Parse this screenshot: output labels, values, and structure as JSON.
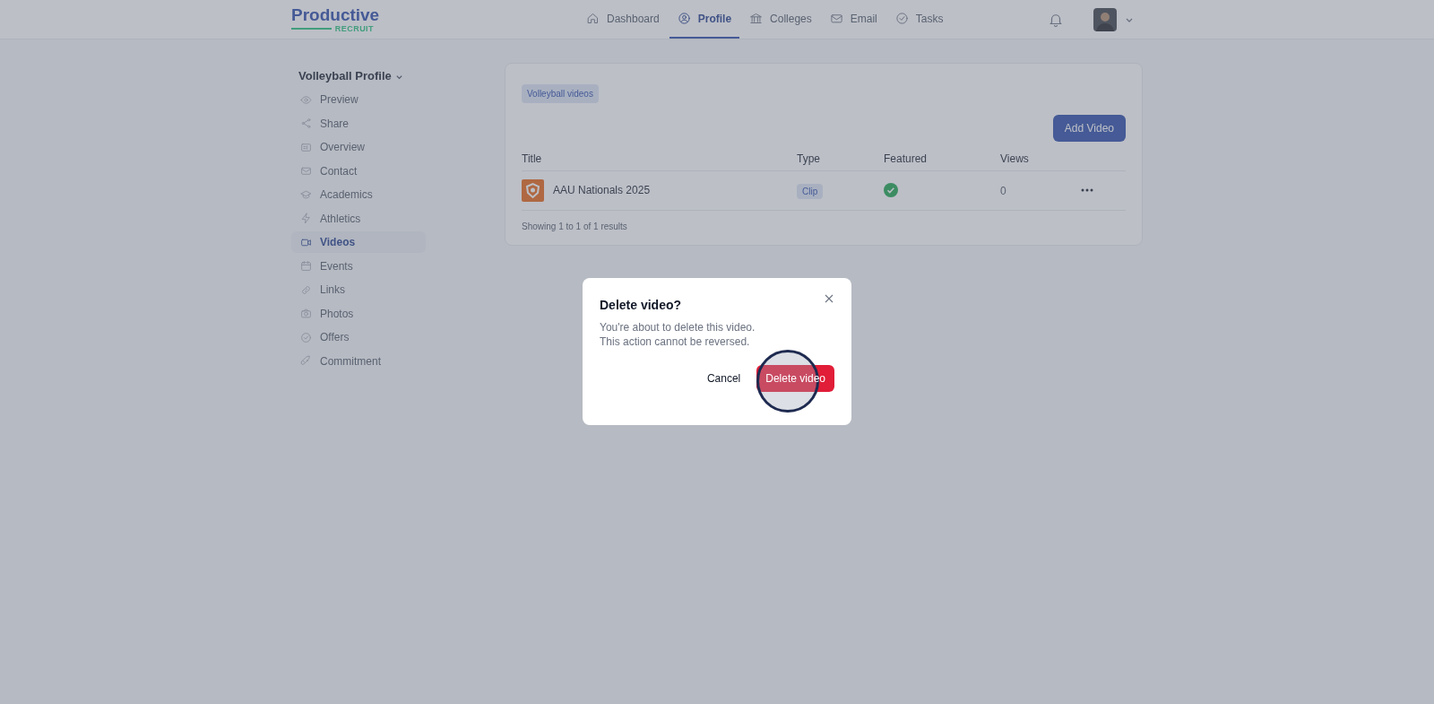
{
  "logo": {
    "word": "Productive",
    "sub": "RECRUIT"
  },
  "nav": [
    {
      "label": "Dashboard",
      "selected": false
    },
    {
      "label": "Profile",
      "selected": true
    },
    {
      "label": "Colleges",
      "selected": false
    },
    {
      "label": "Email",
      "selected": false
    },
    {
      "label": "Tasks",
      "selected": false
    }
  ],
  "sidebar": {
    "title": "Volleyball Profile",
    "items": [
      {
        "label": "Preview",
        "selected": false
      },
      {
        "label": "Share",
        "selected": false
      },
      {
        "label": "Overview",
        "selected": false
      },
      {
        "label": "Contact",
        "selected": false
      },
      {
        "label": "Academics",
        "selected": false
      },
      {
        "label": "Athletics",
        "selected": false
      },
      {
        "label": "Videos",
        "selected": true
      },
      {
        "label": "Events",
        "selected": false
      },
      {
        "label": "Links",
        "selected": false
      },
      {
        "label": "Photos",
        "selected": false
      },
      {
        "label": "Offers",
        "selected": false
      },
      {
        "label": "Commitment",
        "selected": false
      }
    ]
  },
  "videos": {
    "tag": "Volleyball videos",
    "add_button": "Add Video",
    "columns": [
      "Title",
      "Type",
      "Featured",
      "Views"
    ],
    "rows": [
      {
        "title": "AAU Nationals 2025",
        "type": "Clip",
        "featured": true,
        "views": "0"
      }
    ],
    "footer": "Showing 1 to 1 of 1 results"
  },
  "dialog": {
    "title": "Delete video?",
    "message": [
      "You're about to delete this video.",
      "This action cannot be reversed."
    ],
    "cancel": "Cancel",
    "confirm": "Delete video"
  }
}
